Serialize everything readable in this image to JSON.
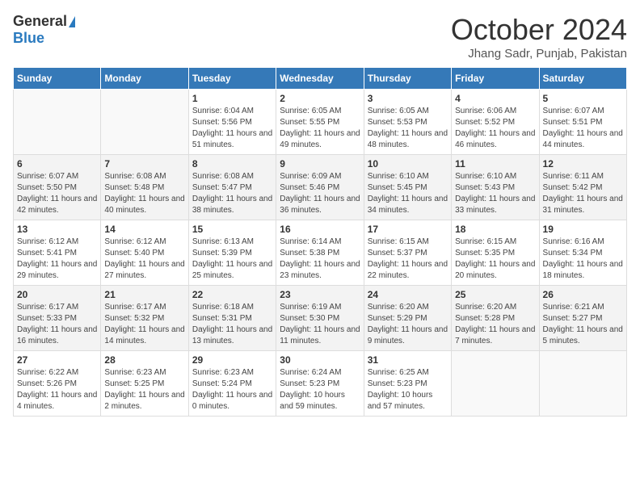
{
  "header": {
    "logo_general": "General",
    "logo_blue": "Blue",
    "month_title": "October 2024",
    "subtitle": "Jhang Sadr, Punjab, Pakistan"
  },
  "days_of_week": [
    "Sunday",
    "Monday",
    "Tuesday",
    "Wednesday",
    "Thursday",
    "Friday",
    "Saturday"
  ],
  "weeks": [
    [
      {
        "day": "",
        "info": ""
      },
      {
        "day": "",
        "info": ""
      },
      {
        "day": "1",
        "info": "Sunrise: 6:04 AM\nSunset: 5:56 PM\nDaylight: 11 hours and 51 minutes."
      },
      {
        "day": "2",
        "info": "Sunrise: 6:05 AM\nSunset: 5:55 PM\nDaylight: 11 hours and 49 minutes."
      },
      {
        "day": "3",
        "info": "Sunrise: 6:05 AM\nSunset: 5:53 PM\nDaylight: 11 hours and 48 minutes."
      },
      {
        "day": "4",
        "info": "Sunrise: 6:06 AM\nSunset: 5:52 PM\nDaylight: 11 hours and 46 minutes."
      },
      {
        "day": "5",
        "info": "Sunrise: 6:07 AM\nSunset: 5:51 PM\nDaylight: 11 hours and 44 minutes."
      }
    ],
    [
      {
        "day": "6",
        "info": "Sunrise: 6:07 AM\nSunset: 5:50 PM\nDaylight: 11 hours and 42 minutes."
      },
      {
        "day": "7",
        "info": "Sunrise: 6:08 AM\nSunset: 5:48 PM\nDaylight: 11 hours and 40 minutes."
      },
      {
        "day": "8",
        "info": "Sunrise: 6:08 AM\nSunset: 5:47 PM\nDaylight: 11 hours and 38 minutes."
      },
      {
        "day": "9",
        "info": "Sunrise: 6:09 AM\nSunset: 5:46 PM\nDaylight: 11 hours and 36 minutes."
      },
      {
        "day": "10",
        "info": "Sunrise: 6:10 AM\nSunset: 5:45 PM\nDaylight: 11 hours and 34 minutes."
      },
      {
        "day": "11",
        "info": "Sunrise: 6:10 AM\nSunset: 5:43 PM\nDaylight: 11 hours and 33 minutes."
      },
      {
        "day": "12",
        "info": "Sunrise: 6:11 AM\nSunset: 5:42 PM\nDaylight: 11 hours and 31 minutes."
      }
    ],
    [
      {
        "day": "13",
        "info": "Sunrise: 6:12 AM\nSunset: 5:41 PM\nDaylight: 11 hours and 29 minutes."
      },
      {
        "day": "14",
        "info": "Sunrise: 6:12 AM\nSunset: 5:40 PM\nDaylight: 11 hours and 27 minutes."
      },
      {
        "day": "15",
        "info": "Sunrise: 6:13 AM\nSunset: 5:39 PM\nDaylight: 11 hours and 25 minutes."
      },
      {
        "day": "16",
        "info": "Sunrise: 6:14 AM\nSunset: 5:38 PM\nDaylight: 11 hours and 23 minutes."
      },
      {
        "day": "17",
        "info": "Sunrise: 6:15 AM\nSunset: 5:37 PM\nDaylight: 11 hours and 22 minutes."
      },
      {
        "day": "18",
        "info": "Sunrise: 6:15 AM\nSunset: 5:35 PM\nDaylight: 11 hours and 20 minutes."
      },
      {
        "day": "19",
        "info": "Sunrise: 6:16 AM\nSunset: 5:34 PM\nDaylight: 11 hours and 18 minutes."
      }
    ],
    [
      {
        "day": "20",
        "info": "Sunrise: 6:17 AM\nSunset: 5:33 PM\nDaylight: 11 hours and 16 minutes."
      },
      {
        "day": "21",
        "info": "Sunrise: 6:17 AM\nSunset: 5:32 PM\nDaylight: 11 hours and 14 minutes."
      },
      {
        "day": "22",
        "info": "Sunrise: 6:18 AM\nSunset: 5:31 PM\nDaylight: 11 hours and 13 minutes."
      },
      {
        "day": "23",
        "info": "Sunrise: 6:19 AM\nSunset: 5:30 PM\nDaylight: 11 hours and 11 minutes."
      },
      {
        "day": "24",
        "info": "Sunrise: 6:20 AM\nSunset: 5:29 PM\nDaylight: 11 hours and 9 minutes."
      },
      {
        "day": "25",
        "info": "Sunrise: 6:20 AM\nSunset: 5:28 PM\nDaylight: 11 hours and 7 minutes."
      },
      {
        "day": "26",
        "info": "Sunrise: 6:21 AM\nSunset: 5:27 PM\nDaylight: 11 hours and 5 minutes."
      }
    ],
    [
      {
        "day": "27",
        "info": "Sunrise: 6:22 AM\nSunset: 5:26 PM\nDaylight: 11 hours and 4 minutes."
      },
      {
        "day": "28",
        "info": "Sunrise: 6:23 AM\nSunset: 5:25 PM\nDaylight: 11 hours and 2 minutes."
      },
      {
        "day": "29",
        "info": "Sunrise: 6:23 AM\nSunset: 5:24 PM\nDaylight: 11 hours and 0 minutes."
      },
      {
        "day": "30",
        "info": "Sunrise: 6:24 AM\nSunset: 5:23 PM\nDaylight: 10 hours and 59 minutes."
      },
      {
        "day": "31",
        "info": "Sunrise: 6:25 AM\nSunset: 5:23 PM\nDaylight: 10 hours and 57 minutes."
      },
      {
        "day": "",
        "info": ""
      },
      {
        "day": "",
        "info": ""
      }
    ]
  ]
}
